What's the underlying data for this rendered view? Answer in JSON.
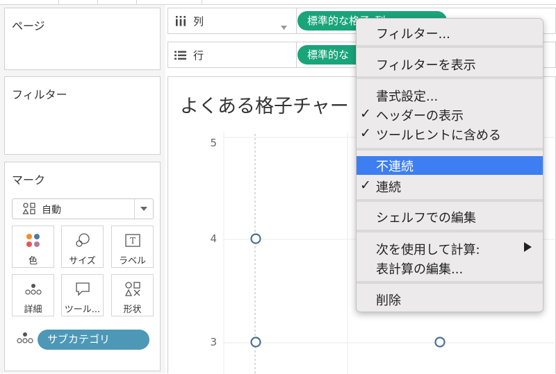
{
  "left_panel": {
    "pages_title": "ページ",
    "filters_title": "フィルター",
    "marks": {
      "title": "マーク",
      "type_dropdown": "自動",
      "buttons": [
        "色",
        "サイズ",
        "ラベル",
        "詳細",
        "ツール...",
        "形状"
      ],
      "detail_pill": "サブカテゴリ"
    }
  },
  "shelves": {
    "columns_label": "列",
    "rows_label": "行",
    "columns_pill": "標準的な格子_列",
    "rows_pill": "標準的な"
  },
  "viz": {
    "title": "よくある格子チャー",
    "y_ticks": [
      "5",
      "4",
      "3"
    ]
  },
  "context_menu": {
    "items": [
      {
        "label": "フィルター..."
      },
      {
        "label": "フィルターを表示"
      },
      {
        "label": "書式設定..."
      },
      {
        "label": "ヘッダーの表示",
        "checked": true
      },
      {
        "label": "ツールヒントに含める",
        "checked": true
      },
      {
        "label": "不連続",
        "highlighted": true
      },
      {
        "label": "連続",
        "checked": true
      },
      {
        "label": "シェルフでの編集"
      },
      {
        "label": "次を使用して計算:",
        "submenu": true
      },
      {
        "label": "表計算の編集..."
      },
      {
        "label": "削除"
      }
    ],
    "check_glyph": "✓"
  },
  "colors": {
    "green_pill": "#1aa47a",
    "blue_pill": "#4d98b6",
    "highlight": "#3d7ef2",
    "marker": "#4a6f96"
  },
  "icons": [
    "column-shelf-icon",
    "row-shelf-icon",
    "marks-automatic-icon",
    "dropdown-caret-icon",
    "color-icon",
    "size-icon",
    "label-icon",
    "detail-icon",
    "tooltip-icon",
    "shape-icon",
    "submenu-arrow-icon"
  ]
}
